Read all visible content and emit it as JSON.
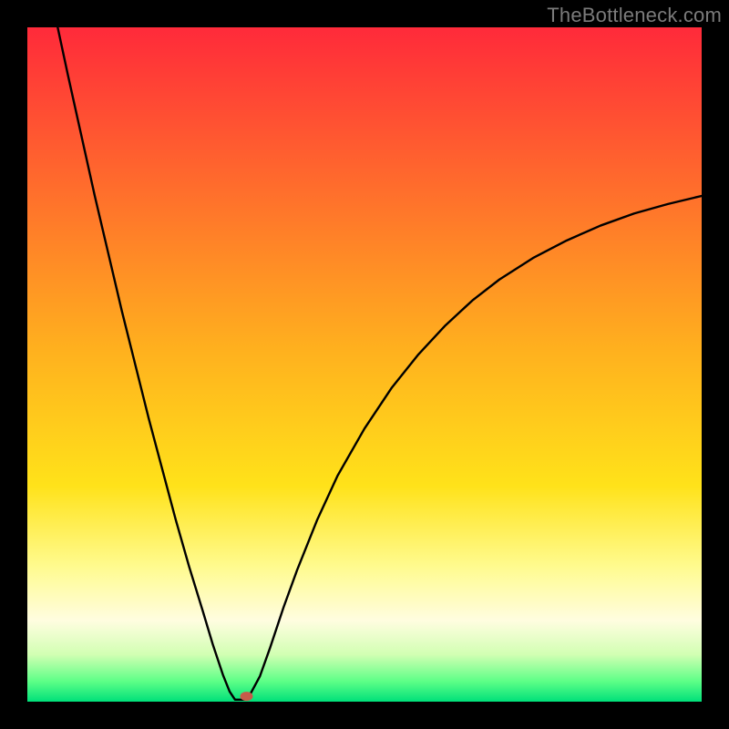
{
  "attribution": "TheBottleneck.com",
  "chart_data": {
    "type": "line",
    "title": "",
    "xlabel": "",
    "ylabel": "",
    "xlim": [
      0,
      100
    ],
    "ylim": [
      0,
      100
    ],
    "gradient_stops": [
      {
        "offset": 0,
        "color": "#ff2a3a"
      },
      {
        "offset": 48,
        "color": "#ffb11e"
      },
      {
        "offset": 68,
        "color": "#ffe21a"
      },
      {
        "offset": 80,
        "color": "#fffb8f"
      },
      {
        "offset": 88,
        "color": "#fffde0"
      },
      {
        "offset": 93,
        "color": "#d2ffb3"
      },
      {
        "offset": 97,
        "color": "#5dff87"
      },
      {
        "offset": 100,
        "color": "#00e07a"
      }
    ],
    "curve_points": [
      {
        "x": 4.5,
        "y": 100.0
      },
      {
        "x": 6.0,
        "y": 93.0
      },
      {
        "x": 8.0,
        "y": 84.0
      },
      {
        "x": 10.0,
        "y": 75.0
      },
      {
        "x": 12.0,
        "y": 66.5
      },
      {
        "x": 14.0,
        "y": 58.0
      },
      {
        "x": 16.0,
        "y": 50.0
      },
      {
        "x": 18.0,
        "y": 42.0
      },
      {
        "x": 20.0,
        "y": 34.5
      },
      {
        "x": 22.0,
        "y": 27.0
      },
      {
        "x": 24.0,
        "y": 20.0
      },
      {
        "x": 26.0,
        "y": 13.5
      },
      {
        "x": 27.5,
        "y": 8.5
      },
      {
        "x": 29.0,
        "y": 4.0
      },
      {
        "x": 30.0,
        "y": 1.5
      },
      {
        "x": 30.8,
        "y": 0.3
      },
      {
        "x": 32.2,
        "y": 0.3
      },
      {
        "x": 33.0,
        "y": 1.0
      },
      {
        "x": 34.5,
        "y": 3.8
      },
      {
        "x": 36.0,
        "y": 8.0
      },
      {
        "x": 38.0,
        "y": 14.0
      },
      {
        "x": 40.0,
        "y": 19.5
      },
      {
        "x": 43.0,
        "y": 27.0
      },
      {
        "x": 46.0,
        "y": 33.5
      },
      {
        "x": 50.0,
        "y": 40.5
      },
      {
        "x": 54.0,
        "y": 46.5
      },
      {
        "x": 58.0,
        "y": 51.5
      },
      {
        "x": 62.0,
        "y": 55.8
      },
      {
        "x": 66.0,
        "y": 59.5
      },
      {
        "x": 70.0,
        "y": 62.6
      },
      {
        "x": 75.0,
        "y": 65.8
      },
      {
        "x": 80.0,
        "y": 68.4
      },
      {
        "x": 85.0,
        "y": 70.6
      },
      {
        "x": 90.0,
        "y": 72.4
      },
      {
        "x": 95.0,
        "y": 73.8
      },
      {
        "x": 100.0,
        "y": 75.0
      }
    ],
    "marker": {
      "x": 32.5,
      "y": 0.8,
      "color": "#c75a4a"
    }
  }
}
